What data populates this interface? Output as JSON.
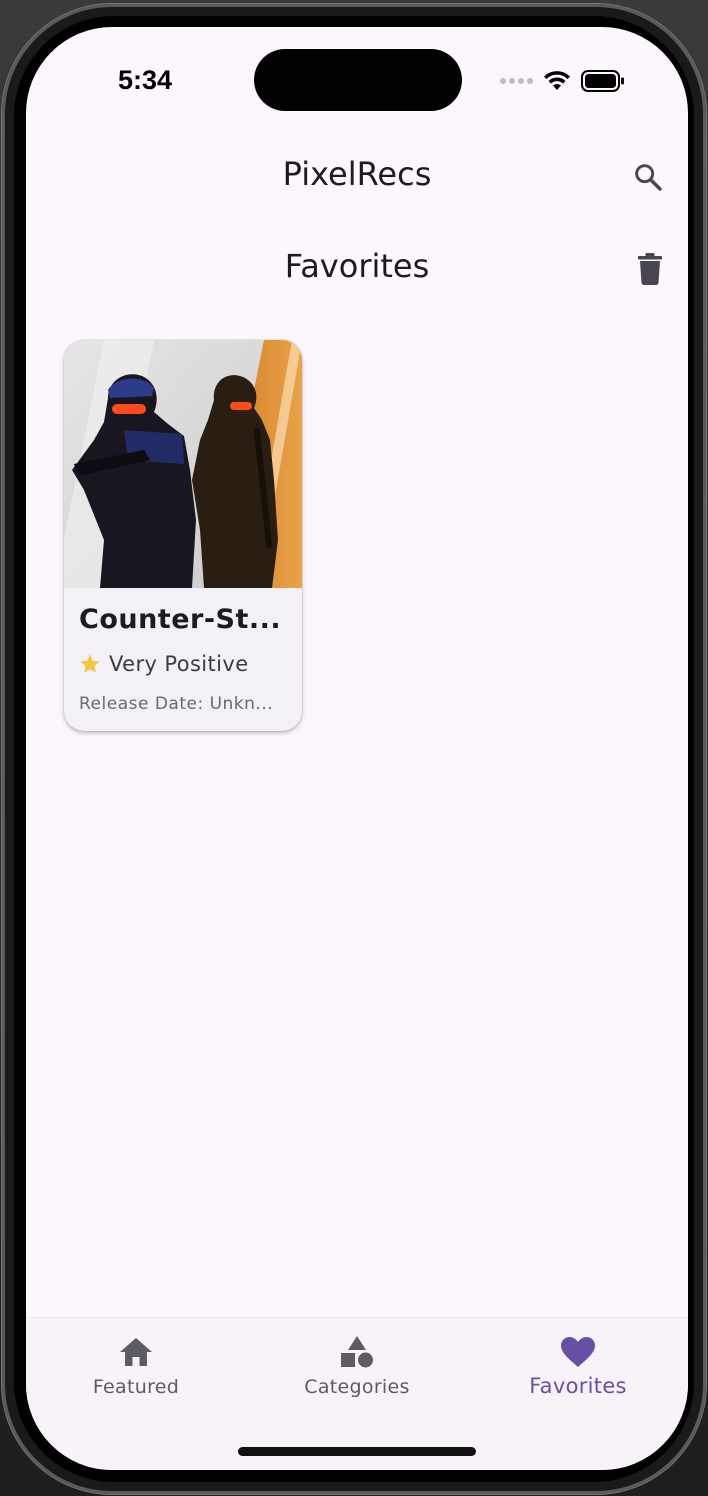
{
  "status_bar": {
    "time": "5:34"
  },
  "app_bar": {
    "title": "PixelRecs",
    "search_icon": "search-icon"
  },
  "section": {
    "title": "Favorites",
    "delete_icon": "trash-icon"
  },
  "favorites": [
    {
      "title": "Counter-St...",
      "rating_icon": "star-icon",
      "rating": "Very Positive",
      "release": "Release Date: Unkn..."
    }
  ],
  "bottom_nav": {
    "items": [
      {
        "label": "Featured",
        "icon": "home-icon",
        "active": false
      },
      {
        "label": "Categories",
        "icon": "shapes-icon",
        "active": false
      },
      {
        "label": "Favorites",
        "icon": "heart-icon",
        "active": true
      }
    ]
  },
  "colors": {
    "background": "#fcf7fc",
    "accent": "#6750a4",
    "star": "#f4c53d",
    "icon_dark": "#49454f"
  }
}
